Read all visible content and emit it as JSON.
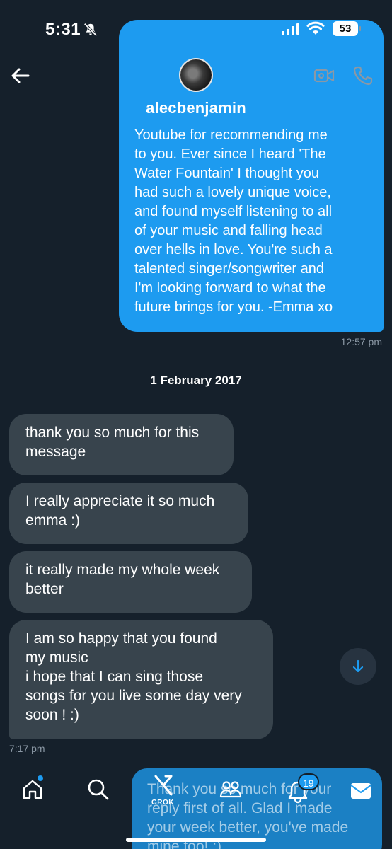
{
  "status_bar": {
    "time": "5:31",
    "battery": "53"
  },
  "header": {
    "username": "alecbenjamin"
  },
  "sent_message": {
    "lines": [
      "Youtube for recommending me",
      "to you. Ever since I heard 'The",
      "Water Fountain' I thought you",
      "had such a lovely unique voice,",
      "and found myself listening to all",
      "of your music and falling head",
      "over hells in love. You're such a",
      "talented singer/songwriter and",
      "I'm looking forward to what the",
      "future brings for you. -Emma xo"
    ],
    "time": "12:57 pm"
  },
  "date_separator": "1 February 2017",
  "received_messages": [
    {
      "lines": [
        "thank you so much for this",
        "message"
      ]
    },
    {
      "lines": [
        "I really appreciate it so much",
        "emma :)"
      ]
    },
    {
      "lines": [
        "it really made my whole week",
        "better"
      ]
    },
    {
      "lines": [
        "I am so happy that you found",
        "my music",
        "i hope that I can sing those",
        "songs for you live some day very",
        "soon ! :)"
      ]
    }
  ],
  "received_time": "7:17 pm",
  "bottom_nav": {
    "items": [
      {
        "icon": "home-icon"
      },
      {
        "icon": "search-icon"
      },
      {
        "icon": "grok-icon",
        "label": "GROK"
      },
      {
        "icon": "communities-icon"
      },
      {
        "icon": "notifications-icon",
        "badge": "19"
      },
      {
        "icon": "messages-icon"
      }
    ]
  },
  "composer_draft": {
    "lines": [
      "Thank you so much for your",
      "reply first of all. Glad I made",
      "your week better, you've made",
      "mine too! :)"
    ]
  },
  "colors": {
    "background": "#15202b",
    "accent": "#1d9bf0",
    "received_bubble": "#38444d",
    "muted_text": "#8b98a5"
  }
}
